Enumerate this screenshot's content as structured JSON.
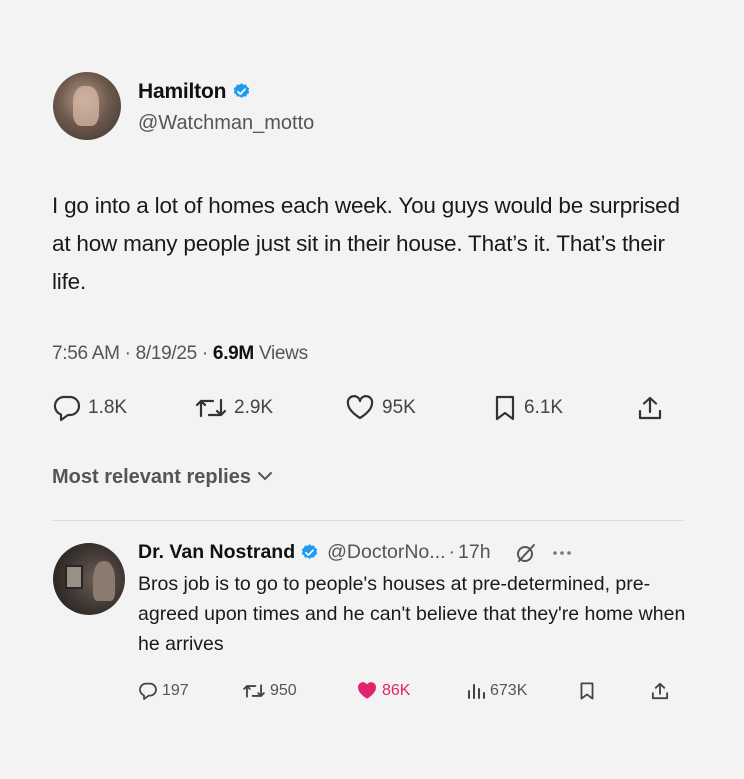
{
  "tweet": {
    "author_name": "Hamilton",
    "author_handle": "@Watchman_motto",
    "text": "I go into a lot of homes each week. You guys would be surprised at how many people just sit in their house. That’s it. That’s their life.",
    "time": "7:56 AM",
    "date": "8/19/25",
    "separator": "·",
    "views_count": "6.9M",
    "views_label": "Views",
    "replies": "1.8K",
    "retweets": "2.9K",
    "likes": "95K",
    "bookmarks": "6.1K"
  },
  "replies_sort_label": "Most relevant replies",
  "reply": {
    "author_name": "Dr. Van Nostrand",
    "author_handle": "@DoctorNo...",
    "separator": "·",
    "time": "17h",
    "text": "Bros job is to go to people's houses at pre-determined, pre-agreed upon times and he can't believe that they're home when he arrives",
    "replies": "197",
    "retweets": "950",
    "likes": "86K",
    "views": "673K"
  },
  "colors": {
    "verified": "#1d9bf0",
    "like_active": "#e2246f",
    "text_secondary": "#555555"
  },
  "icons": [
    "verified-badge-icon",
    "reply-icon",
    "retweet-icon",
    "like-icon",
    "bookmark-icon",
    "share-icon",
    "chevron-down-icon",
    "grok-icon",
    "more-icon",
    "views-icon"
  ]
}
